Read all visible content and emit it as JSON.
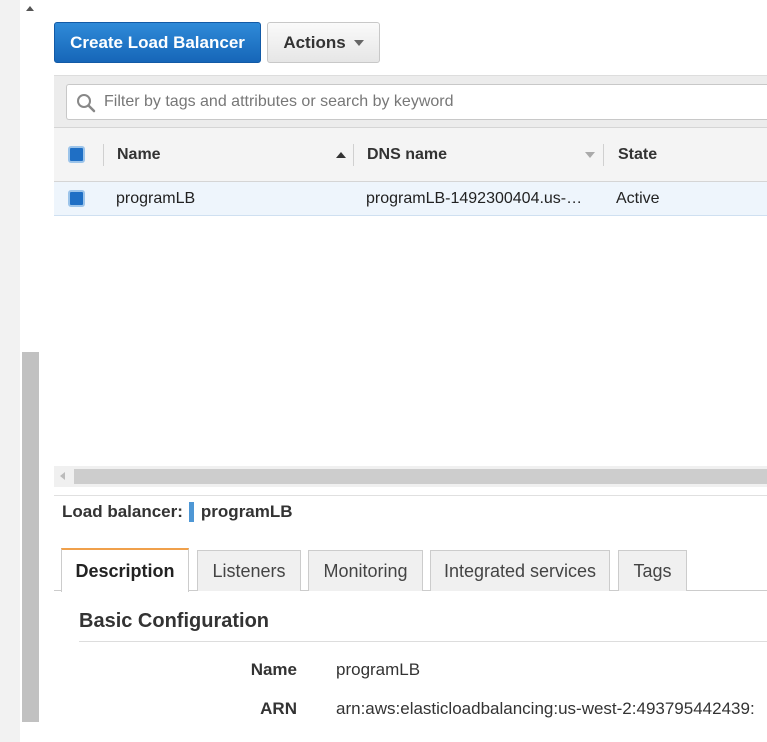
{
  "toolbar": {
    "create_label": "Create Load Balancer",
    "actions_label": "Actions"
  },
  "search": {
    "placeholder": "Filter by tags and attributes or search by keyword"
  },
  "table": {
    "columns": [
      "Name",
      "DNS name",
      "State"
    ],
    "rows": [
      {
        "name": "programLB",
        "dns": "programLB-1492300404.us-…",
        "state": "Active"
      }
    ]
  },
  "detail": {
    "label": "Load balancer:",
    "selected": "programLB"
  },
  "tabs": [
    "Description",
    "Listeners",
    "Monitoring",
    "Integrated services",
    "Tags"
  ],
  "active_tab": "Description",
  "description": {
    "section_title": "Basic Configuration",
    "fields": [
      {
        "key": "Name",
        "value": "programLB"
      },
      {
        "key": "ARN",
        "value": "arn:aws:elasticloadbalancing:us-west-2:493795442439:"
      }
    ]
  },
  "colors": {
    "primary_button": "#1f6fc5",
    "active_tab_accent": "#f0a04b",
    "selected_row": "#eef5fc"
  }
}
